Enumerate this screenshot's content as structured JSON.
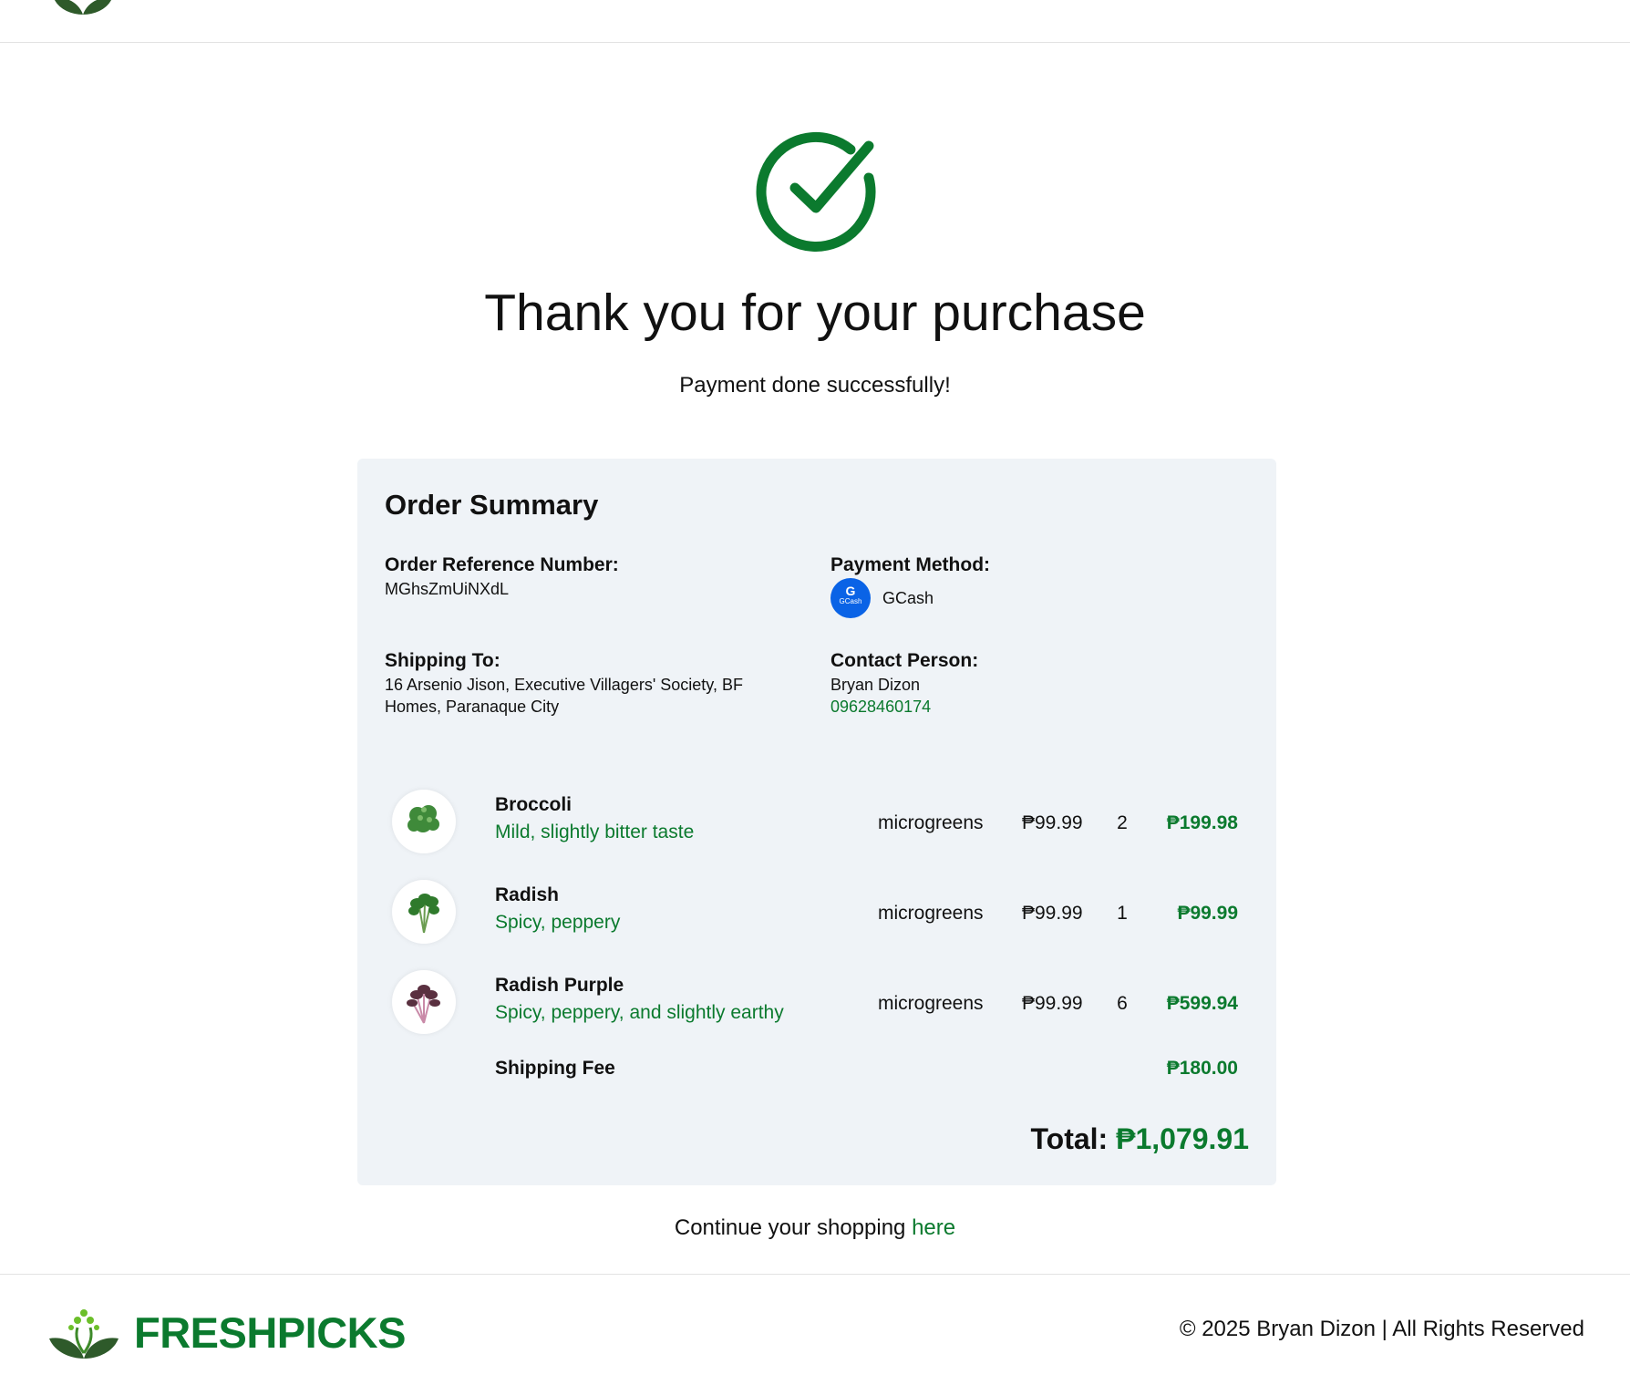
{
  "header": {
    "logo_icon": "leaf-sprout-icon"
  },
  "confirmation": {
    "icon": "check-circle-icon",
    "title": "Thank you for your purchase",
    "subtitle": "Payment done successfully!"
  },
  "order_summary": {
    "title": "Order Summary",
    "reference_label": "Order Reference Number:",
    "reference_value": "MGhsZmUiNXdL",
    "payment_label": "Payment Method:",
    "payment_badge_line1": "G",
    "payment_badge_line2": "GCash",
    "payment_method": "GCash",
    "shipping_label": "Shipping To:",
    "shipping_line1": "16 Arsenio Jison, Executive Villagers' Society, BF",
    "shipping_line2": "Homes, Paranaque City",
    "contact_label": "Contact Person:",
    "contact_name": "Bryan Dizon",
    "contact_phone": "09628460174",
    "items": [
      {
        "name": "Broccoli",
        "description": "Mild, slightly bitter taste",
        "category": "microgreens",
        "price": "₱99.99",
        "qty": "2",
        "subtotal": "₱199.98"
      },
      {
        "name": "Radish",
        "description": "Spicy, peppery",
        "category": "microgreens",
        "price": "₱99.99",
        "qty": "1",
        "subtotal": "₱99.99"
      },
      {
        "name": "Radish Purple",
        "description": "Spicy, peppery, and slightly earthy",
        "category": "microgreens",
        "price": "₱99.99",
        "qty": "6",
        "subtotal": "₱599.94"
      }
    ],
    "shipping_fee_label": "Shipping Fee",
    "shipping_fee": "₱180.00",
    "total_label": "Total:",
    "total_value": "₱1,079.91"
  },
  "continue": {
    "text": "Continue your shopping",
    "link": "here"
  },
  "footer": {
    "brand": "FRESHPICKS",
    "copyright": "© 2025 Bryan Dizon | All Rights Reserved"
  },
  "colors": {
    "brand_green": "#0b7a2e",
    "card_bg": "#eff3f7",
    "gcash_blue": "#0a63e6"
  }
}
